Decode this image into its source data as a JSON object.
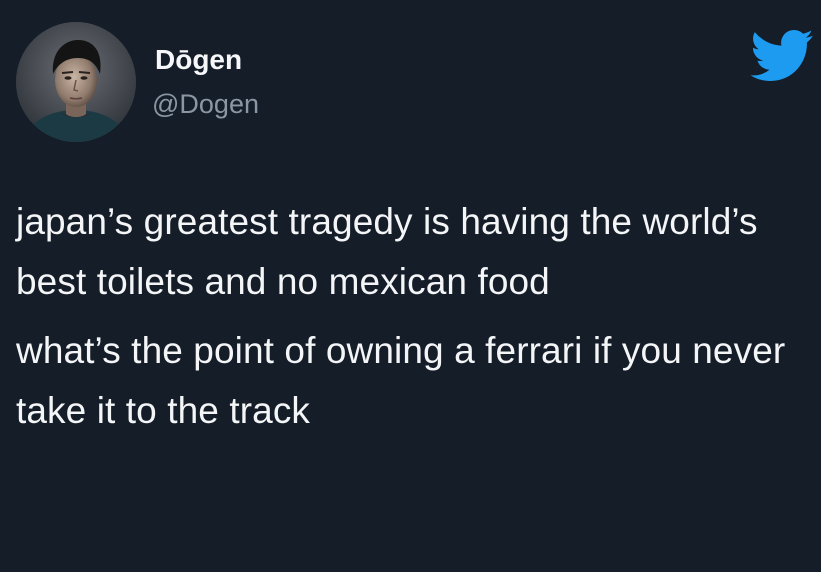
{
  "author": {
    "display_name": "Dōgen",
    "handle": "@Dogen",
    "avatar_icon": "person-portrait-avatar"
  },
  "brand": {
    "icon": "twitter-bird-icon",
    "color": "#1d9bf0"
  },
  "tweet": {
    "paragraphs": [
      "japan’s greatest tragedy is having the world’s best toilets and no mexican food",
      "what’s the point of owning a ferrari if you never take it to the track"
    ]
  },
  "colors": {
    "background": "#151d28",
    "text": "#f3f5f7",
    "handle": "#8a96a3"
  }
}
